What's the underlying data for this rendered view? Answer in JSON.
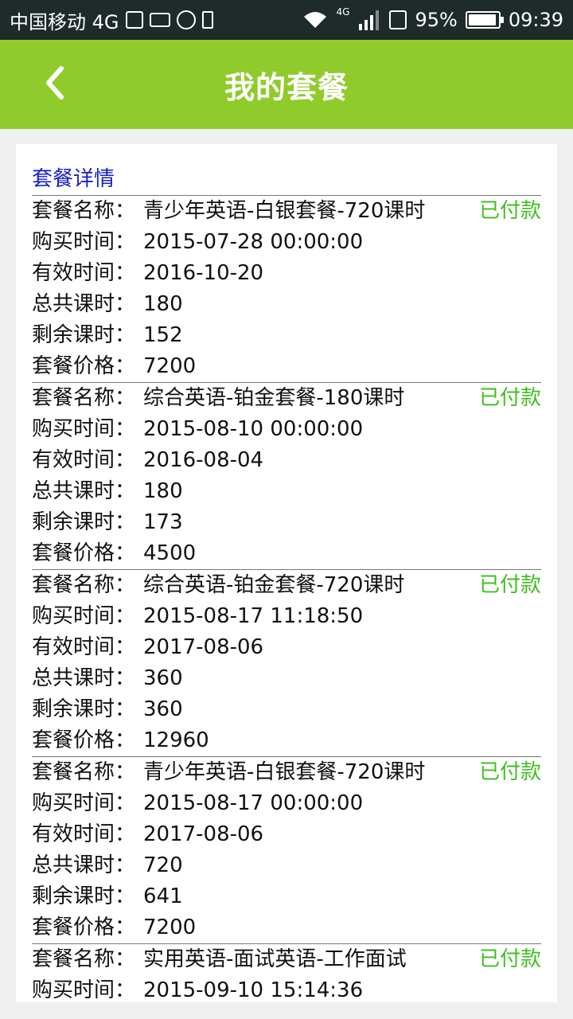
{
  "status_bar": {
    "carrier": "中国移动 4G",
    "network_badge": "4G",
    "battery_pct": "95%",
    "battery_level": 0.95,
    "time": "09:39",
    "icons": [
      "image-icon",
      "keyboard-icon",
      "sync-icon",
      "sim-icon",
      "wifi-icon",
      "signal-icon",
      "phone-data-icon",
      "battery-icon"
    ]
  },
  "header": {
    "title": "我的套餐",
    "back_icon": "chevron-left-icon",
    "bg_color": "#8fcb2b"
  },
  "section": {
    "title": "套餐详情",
    "title_color": "#1620c9"
  },
  "labels": {
    "name": "套餐名称：",
    "purchase": "购买时间：",
    "valid": "有效时间：",
    "total": "总共课时：",
    "remaining": "剩余课时：",
    "price": "套餐价格："
  },
  "status_color": "#3fbf1f",
  "packages": [
    {
      "name": "青少年英语-白银套餐-720课时",
      "status": "已付款",
      "purchase_time": "2015-07-28 00:00:00",
      "valid_until": "2016-10-20",
      "total_hours": "180",
      "remaining_hours": "152",
      "price": "7200"
    },
    {
      "name": "综合英语-铂金套餐-180课时",
      "status": "已付款",
      "purchase_time": "2015-08-10 00:00:00",
      "valid_until": "2016-08-04",
      "total_hours": "180",
      "remaining_hours": "173",
      "price": "4500"
    },
    {
      "name": "综合英语-铂金套餐-720课时",
      "status": "已付款",
      "purchase_time": "2015-08-17 11:18:50",
      "valid_until": "2017-08-06",
      "total_hours": "360",
      "remaining_hours": "360",
      "price": "12960"
    },
    {
      "name": "青少年英语-白银套餐-720课时",
      "status": "已付款",
      "purchase_time": "2015-08-17 00:00:00",
      "valid_until": "2017-08-06",
      "total_hours": "720",
      "remaining_hours": "641",
      "price": "7200"
    },
    {
      "name": "实用英语-面试英语-工作面试",
      "status": "已付款",
      "purchase_time": "2015-09-10 15:14:36",
      "valid_until": "",
      "total_hours": "",
      "remaining_hours": "",
      "price": ""
    }
  ]
}
